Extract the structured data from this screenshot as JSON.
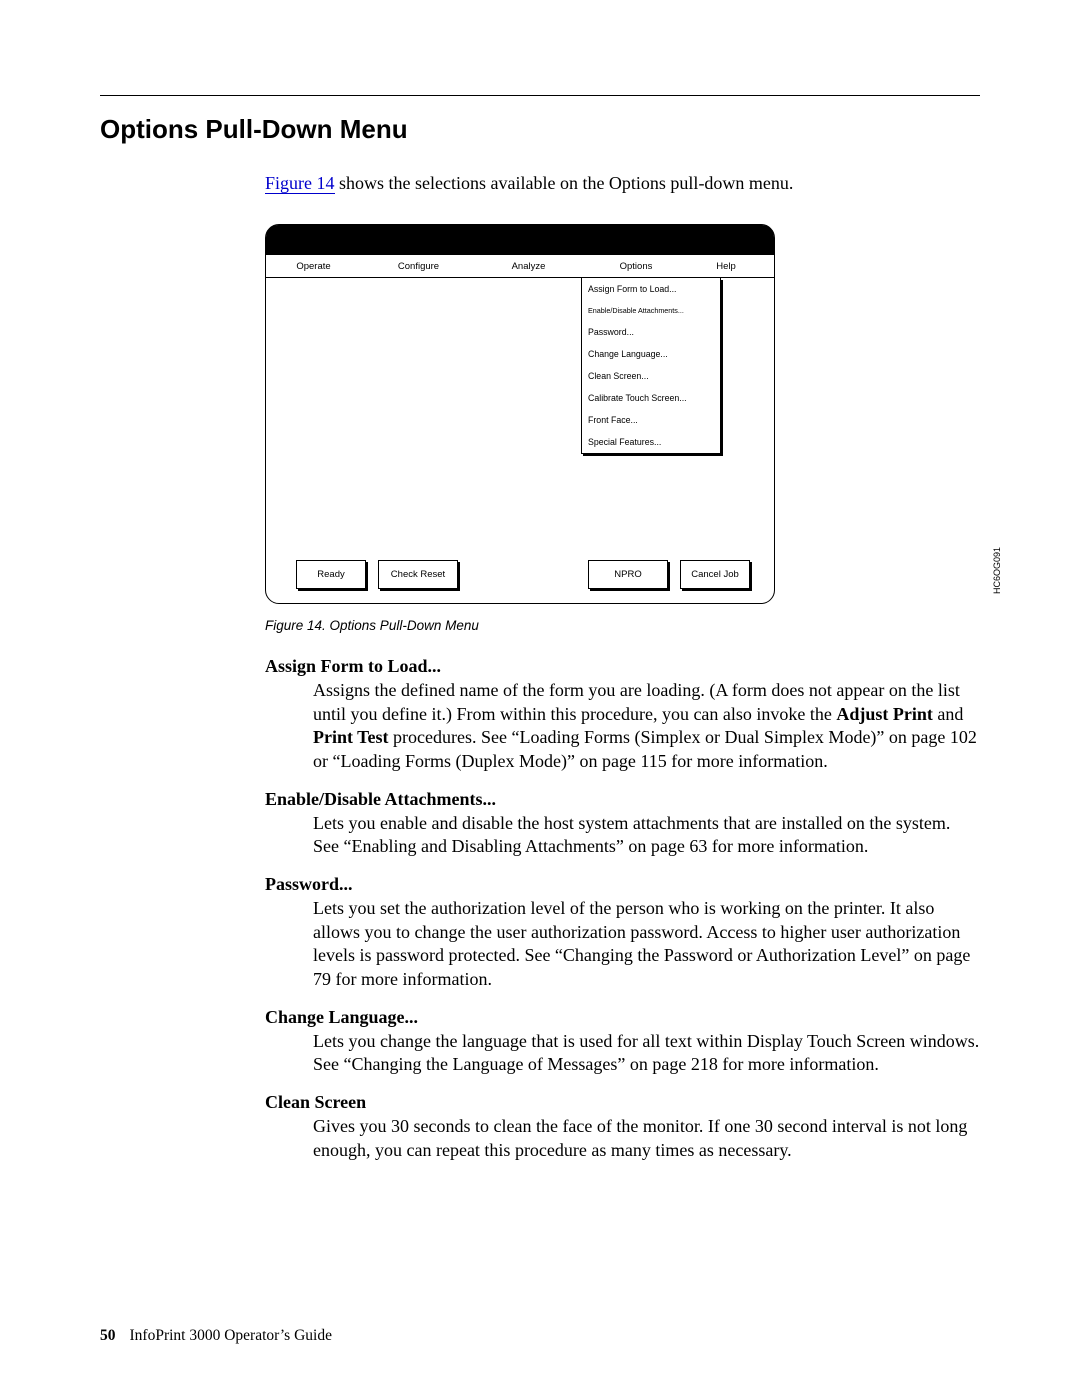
{
  "section_title": "Options Pull-Down Menu",
  "intro": {
    "link_text": "Figure 14",
    "rest": " shows the selections available on the Options pull-down menu."
  },
  "figure": {
    "menubar": [
      "Operate",
      "Configure",
      "Analyze",
      "Options",
      "Help"
    ],
    "dropdown": [
      "Assign Form to Load...",
      "Enable/Disable Attachments...",
      "Password...",
      "Change Language...",
      "Clean Screen...",
      "Calibrate Touch Screen...",
      "Front Face...",
      "Special Features..."
    ],
    "buttons": {
      "ready": "Ready",
      "check_reset": "Check Reset",
      "npro": "NPRO",
      "cancel_job": "Cancel Job"
    },
    "code": "HC6OG091",
    "caption": "Figure 14. Options Pull-Down Menu"
  },
  "definitions": [
    {
      "term": "Assign Form to Load...",
      "body_pre": "Assigns the defined name of the form you are loading. (A form does not appear on the list until you define it.) From within this procedure, you can also invoke the ",
      "bold1": "Adjust Print",
      "mid1": " and ",
      "bold2": "Print Test",
      "body_post": " procedures. See “Loading Forms (Simplex or Dual Simplex Mode)” on page 102 or “Loading Forms (Duplex Mode)” on page 115 for more information."
    },
    {
      "term": "Enable/Disable Attachments...",
      "body": "Lets you enable and disable the host system attachments that are installed on the system. See “Enabling and Disabling Attachments” on page 63 for more information."
    },
    {
      "term": "Password...",
      "body": "Lets you set the authorization level of the person who is working on the printer. It also allows you to change the user authorization password. Access to higher user authorization levels is password protected. See “Changing the Password or Authorization Level” on page 79 for more information."
    },
    {
      "term": "Change Language...",
      "body": "Lets you change the language that is used for all text within Display Touch Screen windows. See “Changing the Language of Messages” on page 218 for more information."
    },
    {
      "term": "Clean Screen",
      "body": "Gives you 30 seconds to clean the face of the monitor. If one 30 second interval is not long enough, you can repeat this procedure as many times as necessary."
    }
  ],
  "footer": {
    "page_number": "50",
    "doc_title": "InfoPrint 3000 Operator’s Guide"
  }
}
